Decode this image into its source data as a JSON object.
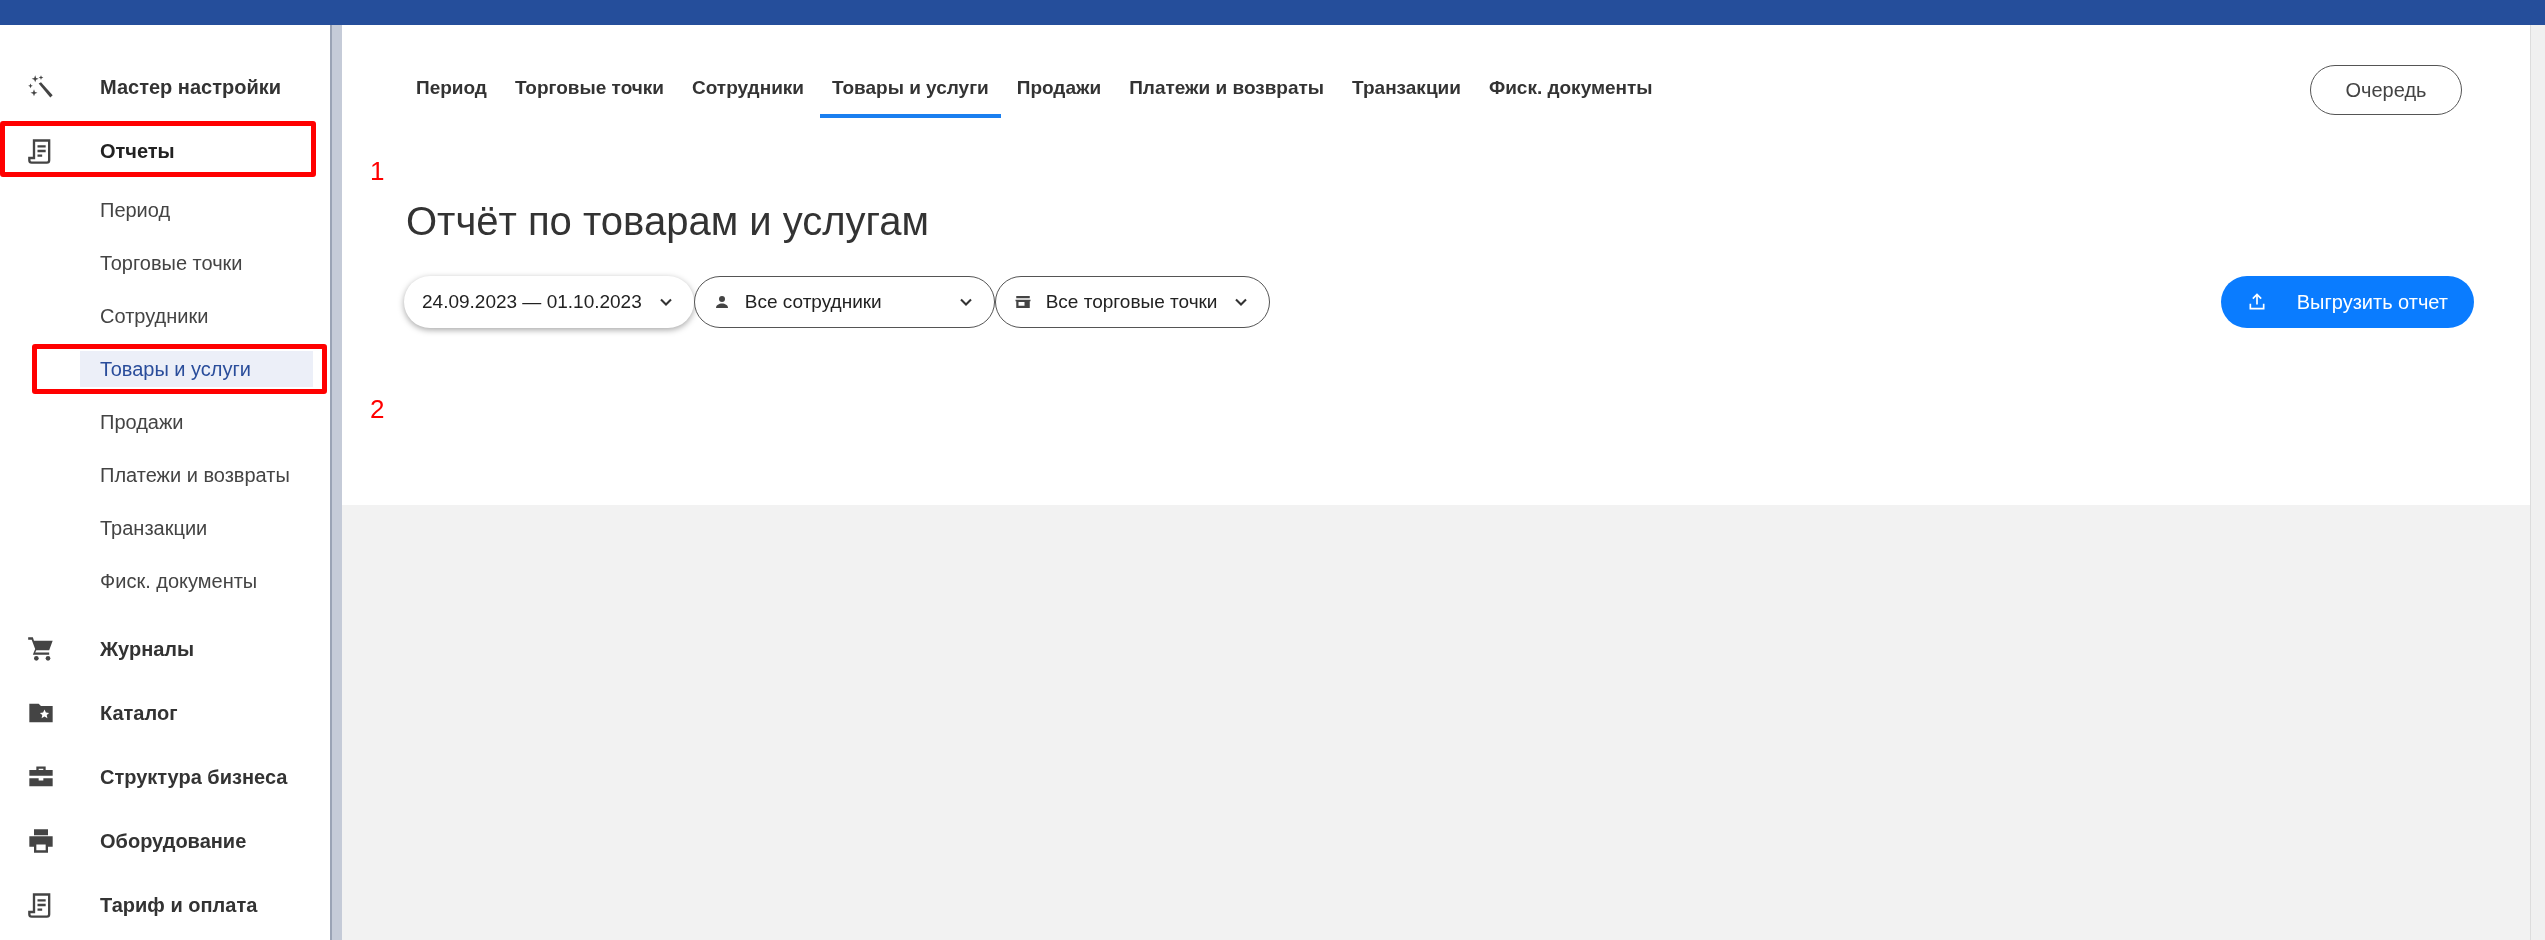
{
  "sidebar": {
    "items": [
      {
        "label": "Мастер настройки",
        "kind": "wand",
        "expanded": false
      },
      {
        "label": "Отчеты",
        "kind": "report",
        "expanded": true,
        "children": [
          {
            "label": "Период",
            "selected": false
          },
          {
            "label": "Торговые точки",
            "selected": false
          },
          {
            "label": "Сотрудники",
            "selected": false
          },
          {
            "label": "Товары и услуги",
            "selected": true
          },
          {
            "label": "Продажи",
            "selected": false
          },
          {
            "label": "Платежи и возвраты",
            "selected": false
          },
          {
            "label": "Транзакции",
            "selected": false
          },
          {
            "label": "Фиск. документы",
            "selected": false
          }
        ]
      },
      {
        "label": "Журналы",
        "kind": "cart",
        "expanded": false
      },
      {
        "label": "Каталог",
        "kind": "folder",
        "expanded": false
      },
      {
        "label": "Структура бизнеса",
        "kind": "briefcase",
        "expanded": false
      },
      {
        "label": "Оборудование",
        "kind": "printer",
        "expanded": false
      },
      {
        "label": "Тариф и оплата",
        "kind": "report",
        "expanded": false
      }
    ]
  },
  "tabs": [
    {
      "label": "Период",
      "selected": false
    },
    {
      "label": "Торговые точки",
      "selected": false
    },
    {
      "label": "Сотрудники",
      "selected": false
    },
    {
      "label": "Товары и услуги",
      "selected": true
    },
    {
      "label": "Продажи",
      "selected": false
    },
    {
      "label": "Платежи и возвраты",
      "selected": false
    },
    {
      "label": "Транзакции",
      "selected": false
    },
    {
      "label": "Фиск. документы",
      "selected": false
    }
  ],
  "queue_button": "Очередь",
  "title": "Отчёт по товарам и услугам",
  "filters": [
    {
      "label": "24.09.2023 — 01.10.2023",
      "kind": "date",
      "raised": true
    },
    {
      "label": "Все сотрудники",
      "kind": "person",
      "raised": false
    },
    {
      "label": "Все торговые точки",
      "kind": "store",
      "raised": false
    }
  ],
  "export_button": "Выгрузить отчет",
  "annotations": [
    {
      "label": "1"
    },
    {
      "label": "2"
    }
  ]
}
